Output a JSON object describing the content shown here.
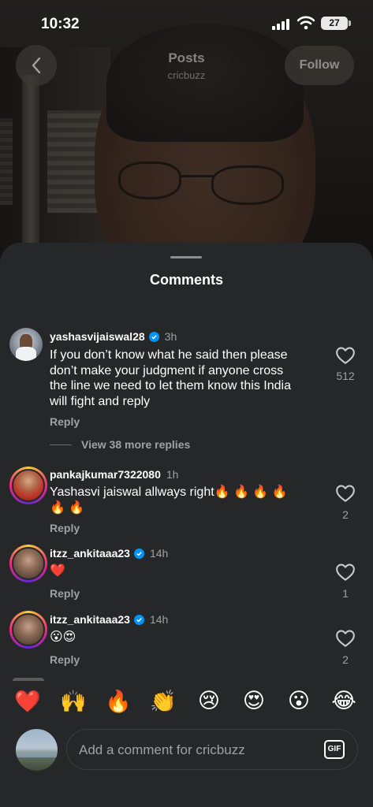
{
  "status_bar": {
    "time": "10:32",
    "battery": "27"
  },
  "header": {
    "title": "Posts",
    "subtitle": "cricbuzz",
    "follow_label": "Follow"
  },
  "sheet": {
    "title": "Comments"
  },
  "comments": [
    {
      "username": "yashasvijaiswal28",
      "verified": true,
      "time": "3h",
      "lines": [
        "If you don’t know what he said then please",
        "don’t make your judgment if  anyone cross",
        "the line we need to let them know this India",
        "will fight and reply"
      ],
      "reply_label": "Reply",
      "likes": "512",
      "more_replies": "View 38 more replies"
    },
    {
      "username": "pankajkumar7322080",
      "verified": false,
      "time": "1h",
      "lines": [
        "Yashasvi jaiswal allways right🔥 🔥 🔥 🔥",
        "🔥 🔥"
      ],
      "reply_label": "Reply",
      "likes": "2"
    },
    {
      "username": "itzz_ankitaaa23",
      "verified": true,
      "time": "14h",
      "lines": [
        "❤️"
      ],
      "reply_label": "Reply",
      "likes": "1"
    },
    {
      "username": "itzz_ankitaaa23",
      "verified": true,
      "time": "14h",
      "lines": [
        "😮😍"
      ],
      "reply_label": "Reply",
      "likes": "2"
    }
  ],
  "emoji_bar": [
    "❤️",
    "🙌",
    "🔥",
    "👏",
    "😢",
    "😍",
    "😮",
    "😂"
  ],
  "input": {
    "placeholder": "Add a comment for cricbuzz",
    "gif_label": "GIF"
  },
  "colors": {
    "sheet_bg": "#262729",
    "secondary_text": "#a0a1a4",
    "verified_blue": "#0095f6"
  }
}
